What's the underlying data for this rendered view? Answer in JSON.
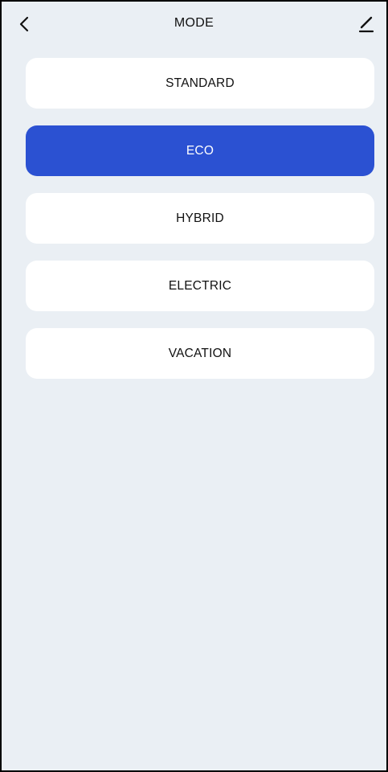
{
  "header": {
    "title": "MODE",
    "back_icon": "chevron-left-icon",
    "edit_icon": "pencil-icon"
  },
  "modes": [
    {
      "label": "STANDARD",
      "selected": false
    },
    {
      "label": "ECO",
      "selected": true
    },
    {
      "label": "HYBRID",
      "selected": false
    },
    {
      "label": "ELECTRIC",
      "selected": false
    },
    {
      "label": "VACATION",
      "selected": false
    }
  ],
  "colors": {
    "background": "#eaeff4",
    "card": "#ffffff",
    "accent": "#2b51d2",
    "text": "#111111",
    "selected_text": "#ffffff"
  }
}
